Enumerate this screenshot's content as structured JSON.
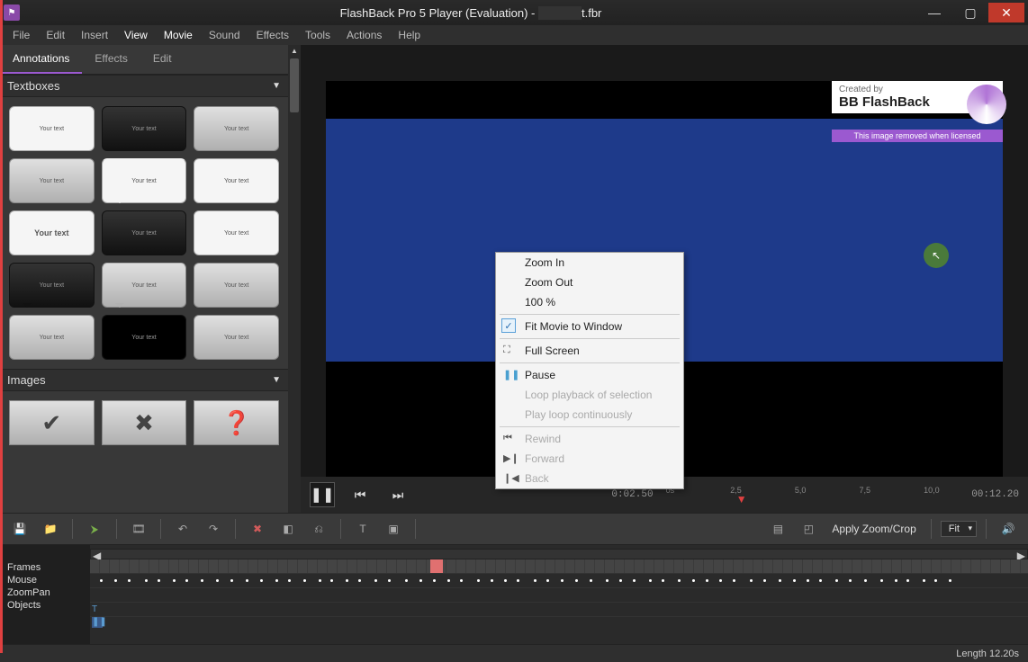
{
  "title": "FlashBack Pro 5 Player (Evaluation) - ",
  "title_suffix": "t.fbr",
  "menu": [
    "File",
    "Edit",
    "Insert",
    "View",
    "Movie",
    "Sound",
    "Effects",
    "Tools",
    "Actions",
    "Help"
  ],
  "menu_active": "View",
  "sidebar_tabs": [
    "Annotations",
    "Effects",
    "Edit"
  ],
  "sidebar_tab_active": "Annotations",
  "panels": {
    "textboxes": "Textboxes",
    "images": "Images"
  },
  "thumb_label": "Your text",
  "watermark": {
    "created": "Created by",
    "brand": "BB FlashBack",
    "strip": "This image removed when licensed"
  },
  "playback": {
    "time_current": "0:02.50",
    "time_total": "00:12.20",
    "ruler": [
      "0s",
      "2,5",
      "5,0",
      "7,5",
      "10,0"
    ]
  },
  "context_menu": {
    "items": [
      {
        "label": "Zoom In",
        "disabled": false
      },
      {
        "label": "Zoom Out",
        "disabled": false
      },
      {
        "label": "100 %",
        "disabled": false
      },
      {
        "label": "Fit Movie to Window",
        "disabled": false,
        "checked": true,
        "sep_before": true
      },
      {
        "label": "Full Screen",
        "disabled": false,
        "icon": "⛶",
        "sep_before": true
      },
      {
        "label": "Pause",
        "disabled": false,
        "icon": "❚❚",
        "sep_before": true,
        "icon_color": "#4aa0d0"
      },
      {
        "label": "Loop playback of selection",
        "disabled": true
      },
      {
        "label": "Play loop continuously",
        "disabled": true
      },
      {
        "label": "Rewind",
        "disabled": true,
        "icon": "⏮",
        "sep_before": true
      },
      {
        "label": "Forward",
        "disabled": true,
        "icon": "▶❙"
      },
      {
        "label": "Back",
        "disabled": true,
        "icon": "❙◀"
      }
    ]
  },
  "toolbar": {
    "apply_zoom": "Apply Zoom/Crop",
    "fit": "Fit"
  },
  "tracks": [
    "Frames",
    "Mouse",
    "ZoomPan",
    "Objects"
  ],
  "status": {
    "length": "Length 12.20s"
  }
}
